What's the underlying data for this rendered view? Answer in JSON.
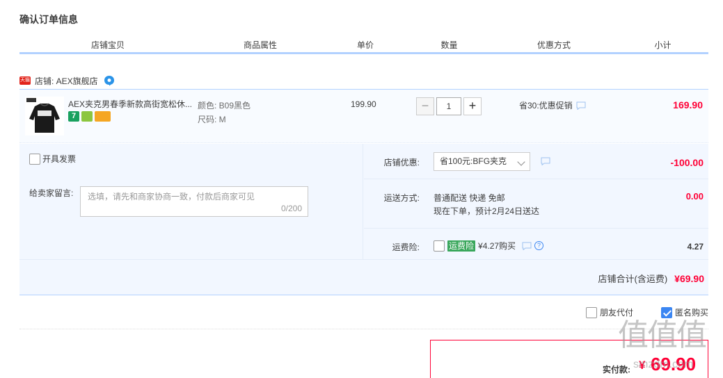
{
  "page_title": "确认订单信息",
  "columns": [
    "店铺宝贝",
    "商品属性",
    "单价",
    "数量",
    "优惠方式",
    "小计"
  ],
  "shop": {
    "platform_badge": "天猫",
    "label": "店铺: AEX旗舰店"
  },
  "item": {
    "title": "AEX夹克男春季新款高街宽松休...",
    "badges": [
      "7"
    ],
    "attr_color": "颜色: B09黑色",
    "attr_size": "尺码: M",
    "unit_price": "199.90",
    "quantity": "1",
    "minus": "−",
    "plus": "+",
    "promo": "省30:优惠促销",
    "subtotal": "169.90"
  },
  "invoice_label": "开具发票",
  "memo": {
    "label": "给卖家留言:",
    "placeholder": "选填，请先和商家协商一致，付款后商家可见",
    "count": "0/200"
  },
  "shop_discount": {
    "label": "店铺优惠:",
    "selected": "省100元:BFG夹克",
    "amount": "-100.00"
  },
  "shipping": {
    "label": "运送方式:",
    "line1": "普通配送 快递 免邮",
    "line2": "现在下单，预计2月24日送达",
    "amount": "0.00"
  },
  "insurance": {
    "label": "运费险:",
    "badge": "运费险",
    "price_text": "¥4.27购买",
    "help": "?",
    "amount": "4.27"
  },
  "shop_total": {
    "label": "店铺合计(含运费)",
    "amount": "¥69.90"
  },
  "friend_pay": "朋友代付",
  "anonymous_buy": "匿名购买",
  "payment": {
    "label": "实付款:",
    "currency": "¥",
    "amount": "69.90"
  },
  "watermark": {
    "glyphs": "值值值",
    "url": "smzdm.com"
  },
  "colors": {
    "accent_red": "#ff0036",
    "header_line": "#b2d1ff",
    "panel_bg": "#f2f7ff",
    "checkbox_blue": "#3b86f2"
  }
}
